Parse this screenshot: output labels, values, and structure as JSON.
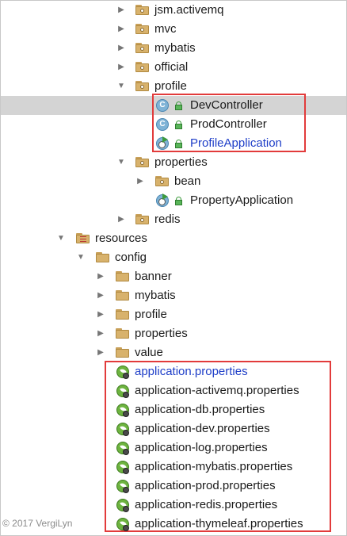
{
  "tree": {
    "packages_top": [
      {
        "label": "jsm.activemq",
        "expanded": false
      },
      {
        "label": "mvc",
        "expanded": false
      },
      {
        "label": "mybatis",
        "expanded": false
      },
      {
        "label": "official",
        "expanded": false
      },
      {
        "label": "profile",
        "expanded": true
      }
    ],
    "profile_children": [
      {
        "label": "DevController",
        "icon": "class-icon",
        "selected": true
      },
      {
        "label": "ProdController",
        "icon": "class-icon"
      },
      {
        "label": "ProfileApplication",
        "icon": "spring-app-icon",
        "highlight_color": "#1e3ec8"
      }
    ],
    "properties_pkg": {
      "label": "properties",
      "expanded": true
    },
    "properties_children": [
      {
        "label": "bean",
        "expanded": false
      },
      {
        "label": "PropertyApplication",
        "icon": "spring-app-icon"
      }
    ],
    "redis_pkg": {
      "label": "redis",
      "expanded": false
    },
    "resources": {
      "label": "resources",
      "expanded": true
    },
    "config": {
      "label": "config",
      "expanded": true
    },
    "config_folders": [
      {
        "label": "banner"
      },
      {
        "label": "mybatis"
      },
      {
        "label": "profile"
      },
      {
        "label": "properties"
      },
      {
        "label": "value"
      }
    ],
    "property_files": [
      {
        "label": "application.properties",
        "highlight_color": "#1e3ec8"
      },
      {
        "label": "application-activemq.properties"
      },
      {
        "label": "application-db.properties"
      },
      {
        "label": "application-dev.properties"
      },
      {
        "label": "application-log.properties"
      },
      {
        "label": "application-mybatis.properties"
      },
      {
        "label": "application-prod.properties"
      },
      {
        "label": "application-redis.properties"
      },
      {
        "label": "application-thymeleaf.properties"
      }
    ]
  },
  "icons": {
    "collapsed": "▶",
    "expanded": "▼"
  },
  "colors": {
    "highlight_box": "#e23b3b",
    "selection": "#d4d4d4",
    "link_text": "#1e3ec8"
  },
  "watermark": "© 2017 VergiLyn"
}
